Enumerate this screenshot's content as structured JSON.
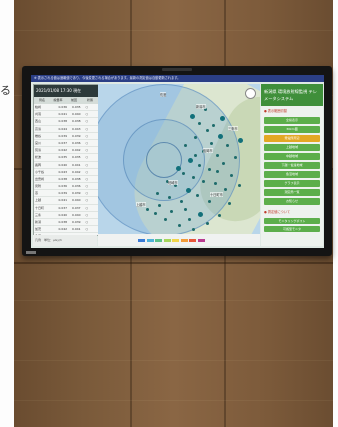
{
  "photo": {
    "kind": "wall-mounted display photo"
  },
  "page_fragment": "る",
  "screen": {
    "notice": "※ 表示される値は速報値であり、今後変更される場合があります。最新の測定値は自動更新されます。",
    "title": "新潟県 環境放射線監視 テレメータシステム",
    "timestamp": "2021/01/08 17:30 現在",
    "table_columns": [
      "局名",
      "線量率",
      "前回",
      "状態"
    ],
    "table_rows": [
      [
        "柏崎",
        "0.036",
        "0.035",
        "○"
      ],
      [
        "刈羽",
        "0.041",
        "0.040",
        "○"
      ],
      [
        "西山",
        "0.038",
        "0.038",
        "○"
      ],
      [
        "高浜",
        "0.044",
        "0.043",
        "○"
      ],
      [
        "椎谷",
        "0.039",
        "0.039",
        "○"
      ],
      [
        "宮川",
        "0.037",
        "0.036",
        "○"
      ],
      [
        "荒浜",
        "0.042",
        "0.042",
        "○"
      ],
      [
        "松波",
        "0.035",
        "0.035",
        "○"
      ],
      [
        "長岡",
        "0.040",
        "0.041",
        "○"
      ],
      [
        "小千谷",
        "0.043",
        "0.042",
        "○"
      ],
      [
        "出雲崎",
        "0.038",
        "0.038",
        "○"
      ],
      [
        "見附",
        "0.036",
        "0.036",
        "○"
      ],
      [
        "燕",
        "0.039",
        "0.039",
        "○"
      ],
      [
        "上越",
        "0.041",
        "0.040",
        "○"
      ],
      [
        "十日町",
        "0.037",
        "0.037",
        "○"
      ],
      [
        "三条",
        "0.040",
        "0.040",
        "○"
      ],
      [
        "新潟",
        "0.038",
        "0.039",
        "○"
      ],
      [
        "加茂",
        "0.042",
        "0.041",
        "○"
      ],
      [
        "魚沼",
        "0.044",
        "0.044",
        "○"
      ]
    ],
    "map_labels": [
      "新潟市",
      "長岡市",
      "上越市",
      "柏崎市",
      "三条市",
      "佐渡",
      "十日町市"
    ],
    "right_subhead": "● 表示範囲切替",
    "right_buttons": [
      {
        "label": "全県表示",
        "active": false
      },
      {
        "label": "30km圏",
        "active": false
      },
      {
        "label": "発電所周辺",
        "active": true
      },
      {
        "label": "上越地域",
        "active": false
      },
      {
        "label": "中越地域",
        "active": false
      },
      {
        "label": "下越・佐渡地域",
        "active": false
      },
      {
        "label": "魚沼地域",
        "active": false
      },
      {
        "label": "グラフ表示",
        "active": false
      },
      {
        "label": "測定局一覧",
        "active": false
      },
      {
        "label": "お知らせ",
        "active": false
      }
    ],
    "right_sub2": "● 測定値について",
    "right_footer_buttons": [
      "モニタリングポスト",
      "可搬型モニタ"
    ],
    "bottom_strip": "凡例　単位：μGy/h",
    "legend_colors": [
      "#3a7bd5",
      "#4fb3d9",
      "#5cc38a",
      "#a6d65a",
      "#f1d54a",
      "#f29c38",
      "#e8573a",
      "#b93a8f"
    ],
    "colors": {
      "title_bg": "#3f8f3a",
      "button": "#5cae4b",
      "button_active": "#e3a824",
      "notice_bg": "#2b3f86"
    }
  }
}
